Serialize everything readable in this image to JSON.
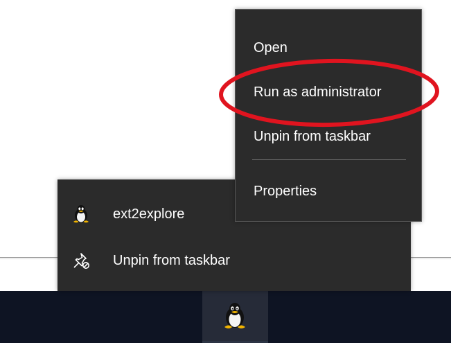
{
  "context_menu": {
    "items": [
      {
        "label": "Open"
      },
      {
        "label": "Run as administrator"
      },
      {
        "label": "Unpin from taskbar"
      },
      {
        "label": "Properties"
      }
    ]
  },
  "jump_list": {
    "items": [
      {
        "label": "ext2explore",
        "icon": "tux-icon"
      },
      {
        "label": "Unpin from taskbar",
        "icon": "unpin-icon"
      }
    ]
  },
  "taskbar": {
    "pinned_app_icon": "tux-icon"
  },
  "annotation": {
    "color": "#e0141f",
    "target": "Run as administrator"
  },
  "colors": {
    "menu_background": "#2b2b2b",
    "taskbar_background": "#0e1423",
    "menu_text": "#ffffff"
  }
}
